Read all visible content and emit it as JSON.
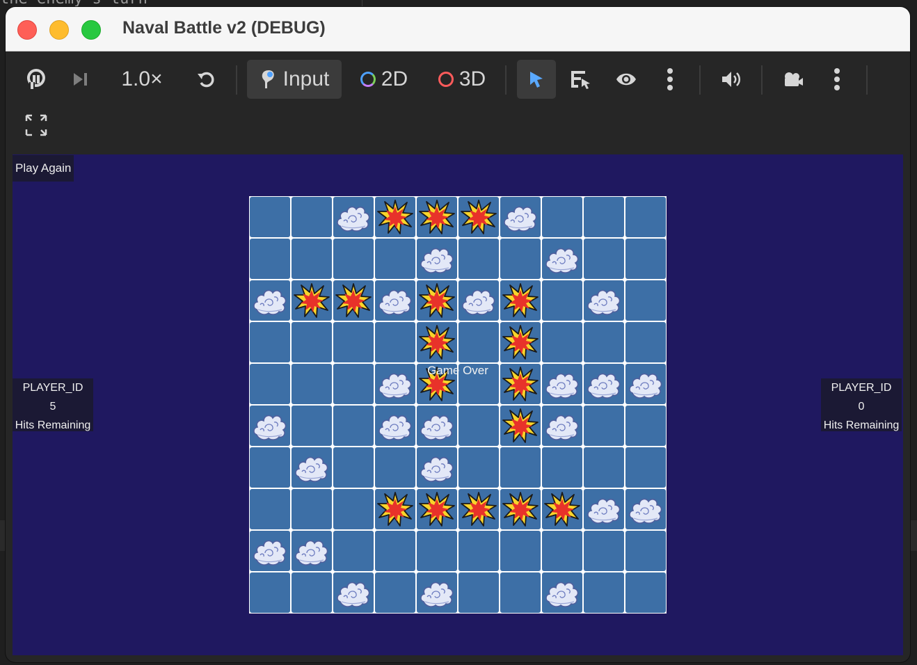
{
  "background_text": "the enemy's turn",
  "window": {
    "title": "Naval Battle v2 (DEBUG)"
  },
  "toolbar": {
    "speed_label": "1.0×",
    "input_label": "Input",
    "mode_2d_label": "2D",
    "mode_3d_label": "3D",
    "colors": {
      "ring_2d": "#4ea1ff",
      "ring_3d": "#ff5b5b",
      "select_active": "#5aa9ff"
    }
  },
  "game": {
    "play_again_label": "Play Again",
    "game_over_label": "Game Over",
    "left_player": {
      "id": "PLAYER_ID",
      "hits": "5",
      "hits_label": "Hits Remaining"
    },
    "right_player": {
      "id": "PLAYER_ID",
      "hits": "0",
      "hits_label": "Hits Remaining"
    },
    "board_legend": {
      "M": "miss (smoke)",
      "H": "hit (explosion)",
      ".": "empty water"
    },
    "board": [
      "..MHHHM...",
      "....M..M..",
      "MHHMHMH.M.",
      "....H.H...",
      "...MH.HMMM",
      "M..MM.HM..",
      ".M..M.....",
      "...HHHHHMM",
      "MM........",
      "..M.M..M.."
    ]
  }
}
